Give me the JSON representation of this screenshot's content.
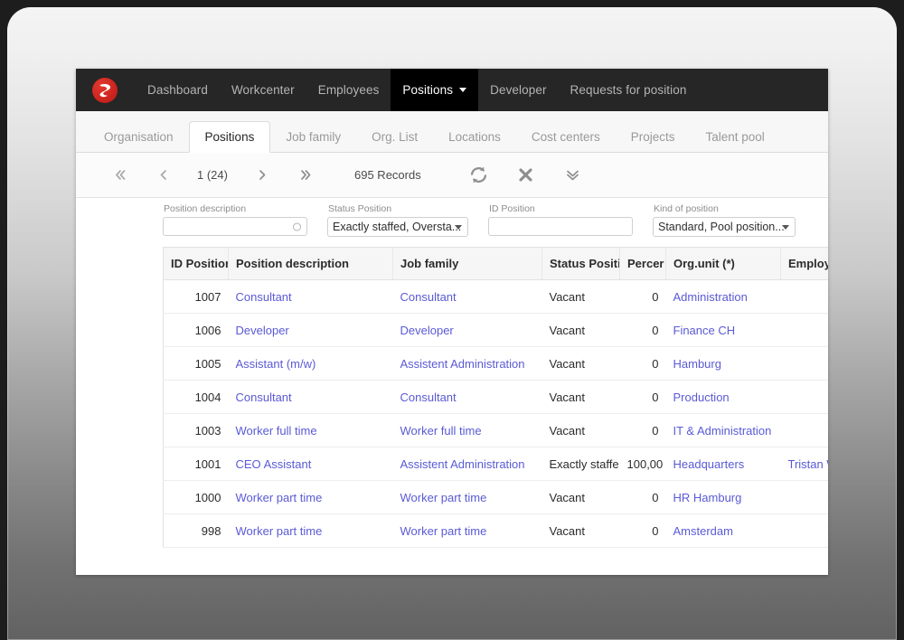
{
  "navbar": {
    "logo_icon": "brand-swoosh-logo",
    "items": [
      {
        "label": "Dashboard",
        "active": false,
        "caret": false
      },
      {
        "label": "Workcenter",
        "active": false,
        "caret": false
      },
      {
        "label": "Employees",
        "active": false,
        "caret": false
      },
      {
        "label": "Positions",
        "active": true,
        "caret": true
      },
      {
        "label": "Developer",
        "active": false,
        "caret": false
      },
      {
        "label": "Requests for position",
        "active": false,
        "caret": false
      }
    ]
  },
  "subtabs": {
    "items": [
      {
        "label": "Organisation",
        "active": false
      },
      {
        "label": "Positions",
        "active": true
      },
      {
        "label": "Job family",
        "active": false
      },
      {
        "label": "Org. List",
        "active": false
      },
      {
        "label": "Locations",
        "active": false
      },
      {
        "label": "Cost centers",
        "active": false
      },
      {
        "label": "Projects",
        "active": false
      },
      {
        "label": "Talent pool",
        "active": false
      }
    ]
  },
  "toolbar": {
    "first_icon": "double-chevron-left-icon",
    "prev_icon": "chevron-left-icon",
    "page_indicator": "1 (24)",
    "next_icon": "chevron-right-icon",
    "last_icon": "double-chevron-right-icon",
    "record_count": "695 Records",
    "refresh_icon": "refresh-icon",
    "close_icon": "close-x-icon",
    "expand_icon": "double-chevron-down-icon"
  },
  "filters": {
    "position_description": {
      "label": "Position description",
      "value": "",
      "placeholder": "",
      "icon": "lookup-circle-icon"
    },
    "status_position": {
      "label": "Status Position",
      "value": "Exactly staffed, Oversta..."
    },
    "id_position": {
      "label": "ID Position",
      "value": "",
      "placeholder": ""
    },
    "kind_of_position": {
      "label": "Kind of position",
      "value": "Standard, Pool position..."
    }
  },
  "table": {
    "columns": [
      "ID Positior",
      "Position description",
      "Job family",
      "Status Positi",
      "Percer",
      "Org.unit (*)",
      "Employee name (*)"
    ],
    "rows": [
      {
        "id": "1007",
        "description": "Consultant",
        "job_family": "Consultant",
        "status": "Vacant",
        "percent": "0",
        "org_unit": "Administration",
        "employee": ""
      },
      {
        "id": "1006",
        "description": "Developer",
        "job_family": "Developer",
        "status": "Vacant",
        "percent": "0",
        "org_unit": "Finance CH",
        "employee": ""
      },
      {
        "id": "1005",
        "description": "Assistant (m/w)",
        "job_family": "Assistent Administration",
        "status": "Vacant",
        "percent": "0",
        "org_unit": "Hamburg",
        "employee": ""
      },
      {
        "id": "1004",
        "description": "Consultant",
        "job_family": "Consultant",
        "status": "Vacant",
        "percent": "0",
        "org_unit": "Production",
        "employee": ""
      },
      {
        "id": "1003",
        "description": "Worker full time",
        "job_family": "Worker full time",
        "status": "Vacant",
        "percent": "0",
        "org_unit": "IT & Administration",
        "employee": ""
      },
      {
        "id": "1001",
        "description": "CEO Assistant",
        "job_family": "Assistent Administration",
        "status": "Exactly staffe",
        "percent": "100,00",
        "org_unit": "Headquarters",
        "employee": "Tristan Wichlig"
      },
      {
        "id": "1000",
        "description": "Worker part time",
        "job_family": "Worker part time",
        "status": "Vacant",
        "percent": "0",
        "org_unit": "HR Hamburg",
        "employee": ""
      },
      {
        "id": "998",
        "description": "Worker part time",
        "job_family": "Worker part time",
        "status": "Vacant",
        "percent": "0",
        "org_unit": "Amsterdam",
        "employee": ""
      }
    ]
  },
  "colors": {
    "navbar_bg": "#262626",
    "navbar_active_bg": "#000000",
    "brand_red": "#cf2620",
    "link_blue": "#5a5ad6"
  }
}
